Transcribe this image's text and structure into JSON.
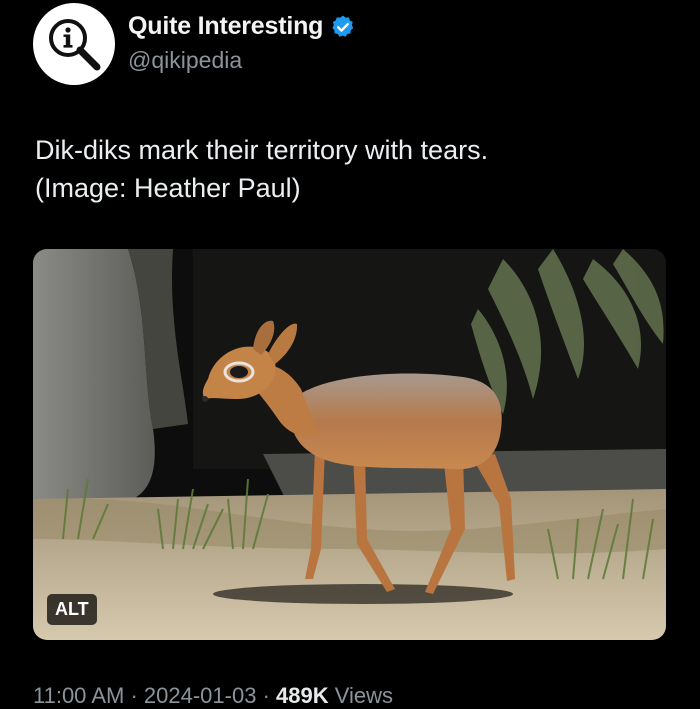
{
  "author": {
    "display_name": "Quite Interesting",
    "handle": "@qikipedia",
    "verified": true,
    "avatar_icon": "magnifier-info-icon",
    "verified_color": "#1d9bf0"
  },
  "tweet": {
    "text_lines": [
      "Dik-diks mark their territory with tears.",
      "(Image: Heather Paul)"
    ]
  },
  "media": {
    "alt_badge": "ALT"
  },
  "meta": {
    "time": "11:00 AM",
    "date": "2024-01-03",
    "views_count": "489K",
    "views_label": "Views",
    "separator": "·"
  }
}
